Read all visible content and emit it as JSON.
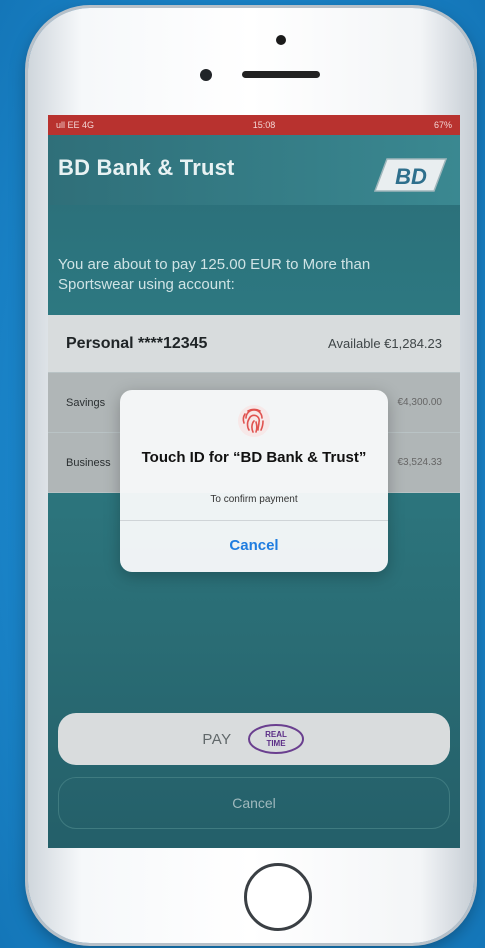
{
  "status_bar": {
    "carrier": "ull EE 4G",
    "time": "15:08",
    "battery": "67%"
  },
  "header": {
    "title": "BD Bank & Trust",
    "logo_text": "BD"
  },
  "intro_text": "You are about to pay 125.00 EUR to More than Sportswear using account:",
  "accounts": [
    {
      "name": "Personal ****12345",
      "available": "Available €1,284.23"
    },
    {
      "name": "Savings",
      "available": "€4,300.00"
    },
    {
      "name": "Business",
      "available": "€3,524.33"
    }
  ],
  "pay_button": {
    "label": "PAY",
    "logo_text": "REAL TIME"
  },
  "cancel_button": {
    "label": "Cancel"
  },
  "touch_id_dialog": {
    "title": "Touch ID for “BD Bank & Trust”",
    "subtitle": "To confirm payment",
    "cancel_label": "Cancel"
  },
  "colors": {
    "accent": "#1f7de0",
    "status_bar": "#b8322f",
    "screen_bg": "#2e7c84"
  }
}
